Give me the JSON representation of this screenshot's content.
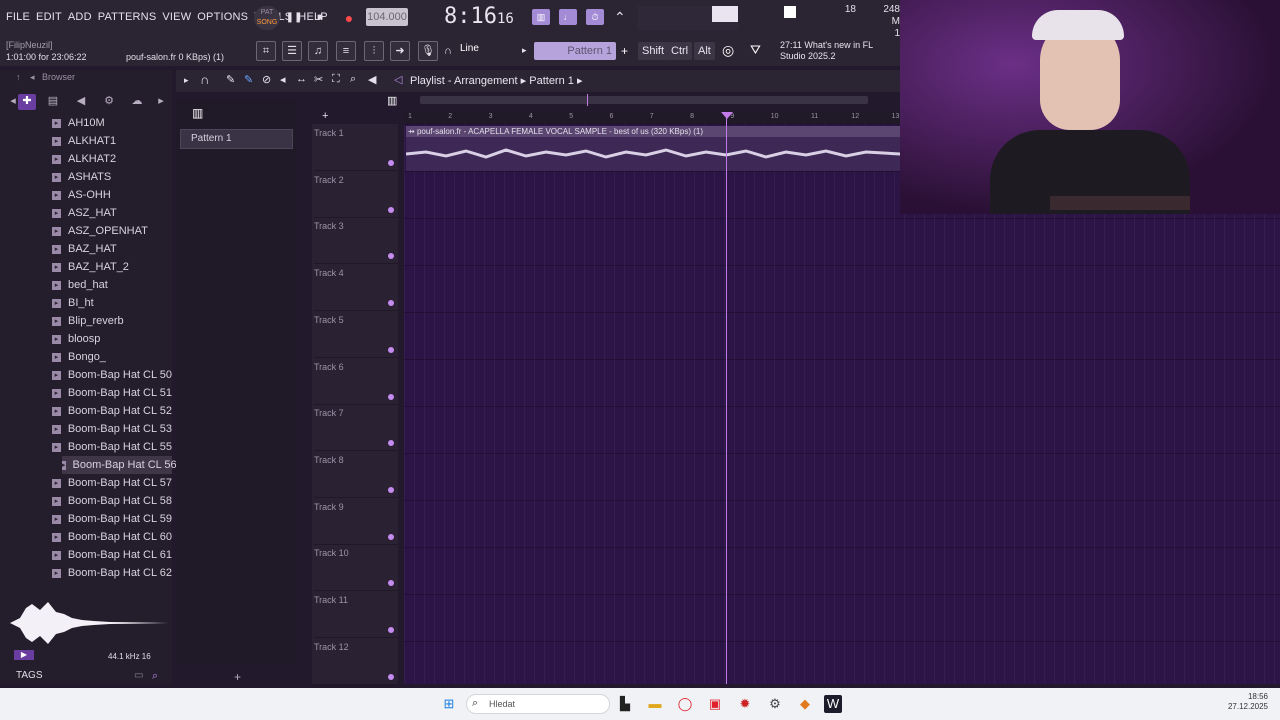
{
  "menu": [
    "FILE",
    "EDIT",
    "ADD",
    "PATTERNS",
    "VIEW",
    "OPTIONS",
    "TOOLS",
    "HELP"
  ],
  "transport": {
    "pat": "PAT",
    "song": "SONG",
    "bpm": "104.000",
    "time": "8:16",
    "time_sub": "16"
  },
  "stats": {
    "cpu": "18",
    "ram": "248 M",
    "ram_sub": "1"
  },
  "hint": {
    "user": "[FilipNeuzil]",
    "position": "1:01:00 for 23:06:22",
    "file": "pouf-salon.fr 0 KBps) (1)"
  },
  "toolbar": {
    "snap": "Line",
    "pattern": "Pattern 1",
    "keys": [
      "Shift",
      "Ctrl",
      "Alt"
    ],
    "news": "27:11  What's new in FL Studio 2025.2"
  },
  "browser": {
    "title": "Browser",
    "items": [
      "AH10M",
      "ALKHAT1",
      "ALKHAT2",
      "ASHATS",
      "AS-OHH",
      "ASZ_HAT",
      "ASZ_OPENHAT",
      "BAZ_HAT",
      "BAZ_HAT_2",
      "bed_hat",
      "BI_ht",
      "Blip_reverb",
      "bloosp",
      "Bongo_",
      "Boom-Bap Hat CL 50",
      "Boom-Bap Hat CL 51",
      "Boom-Bap Hat CL 52",
      "Boom-Bap Hat CL 53",
      "Boom-Bap Hat CL 55",
      "Boom-Bap Hat CL 56",
      "Boom-Bap Hat CL 57",
      "Boom-Bap Hat CL 58",
      "Boom-Bap Hat CL 59",
      "Boom-Bap Hat CL 60",
      "Boom-Bap Hat CL 61",
      "Boom-Bap Hat CL 62"
    ],
    "selected": "Boom-Bap Hat CL 56",
    "samplerate": "44.1 kHz 16",
    "tags": "TAGS"
  },
  "patterns": {
    "item": "Pattern 1"
  },
  "playlist": {
    "title": "Playlist - Arrangement",
    "pattern": "Pattern 1",
    "clip": "pouf-salon.fr - ACAPELLA FEMALE VOCAL SAMPLE - best of us (320 KBps) (1)",
    "tracks": [
      "Track 1",
      "Track 2",
      "Track 3",
      "Track 4",
      "Track 5",
      "Track 6",
      "Track 7",
      "Track 8",
      "Track 9",
      "Track 10",
      "Track 11",
      "Track 12"
    ],
    "ruler": [
      "1",
      "2",
      "3",
      "4",
      "5",
      "6",
      "7",
      "8",
      "9",
      "10",
      "11",
      "12",
      "13"
    ]
  },
  "taskbar": {
    "search": "Hledat",
    "time": "18:56",
    "date": "27.12.2025"
  }
}
